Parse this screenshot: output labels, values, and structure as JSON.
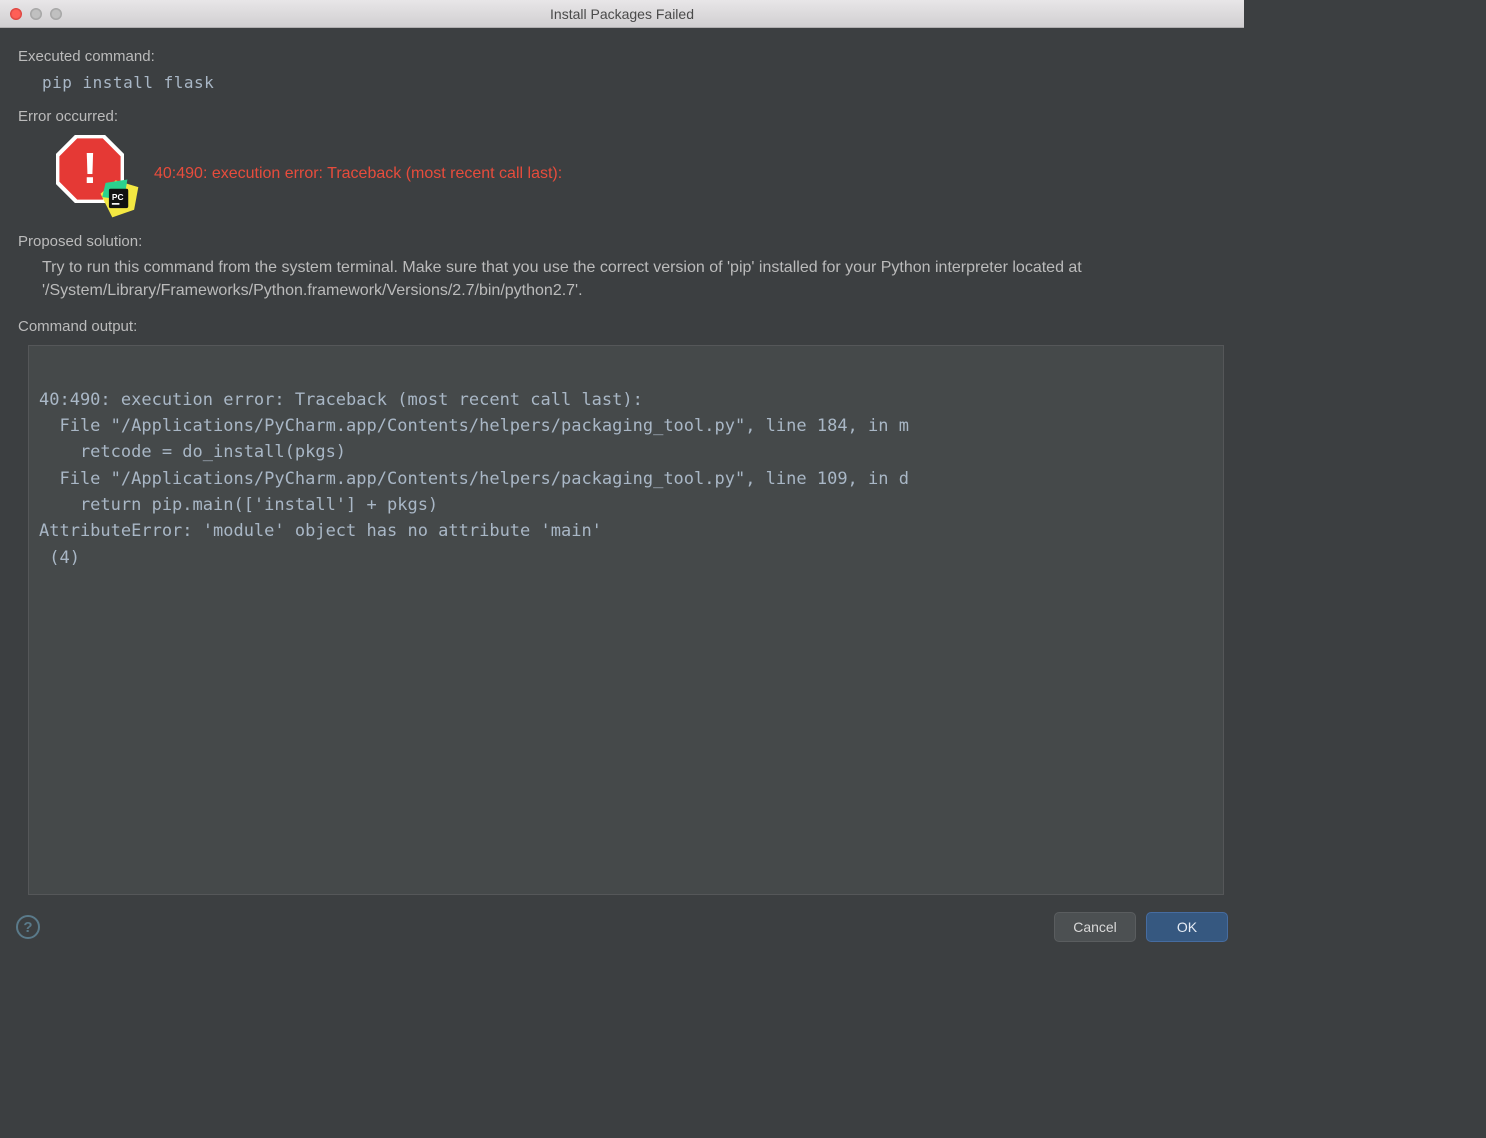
{
  "window": {
    "title": "Install Packages Failed"
  },
  "labels": {
    "executed_command": "Executed command:",
    "error_occurred": "Error occurred:",
    "proposed_solution": "Proposed solution:",
    "command_output": "Command output:"
  },
  "command": "pip install flask",
  "error_message": "40:490: execution error: Traceback (most recent call last):",
  "solution_text": "Try to run this command from the system terminal. Make sure that you use the correct version of 'pip' installed for your Python interpreter located at '/System/Library/Frameworks/Python.framework/Versions/2.7/bin/python2.7'.",
  "command_output": "\n40:490: execution error: Traceback (most recent call last):\n  File \"/Applications/PyCharm.app/Contents/helpers/packaging_tool.py\", line 184, in m\n    retcode = do_install(pkgs)\n  File \"/Applications/PyCharm.app/Contents/helpers/packaging_tool.py\", line 109, in d\n    return pip.main(['install'] + pkgs)\nAttributeError: 'module' object has no attribute 'main'\n (4)\n",
  "buttons": {
    "cancel": "Cancel",
    "ok": "OK"
  },
  "icons": {
    "error": "stop-sign-exclamation",
    "app_badge": "pycharm",
    "help": "?"
  },
  "colors": {
    "error_red": "#e74c3c",
    "bg": "#3c3f41",
    "panel": "#45494a",
    "primary": "#365880"
  }
}
